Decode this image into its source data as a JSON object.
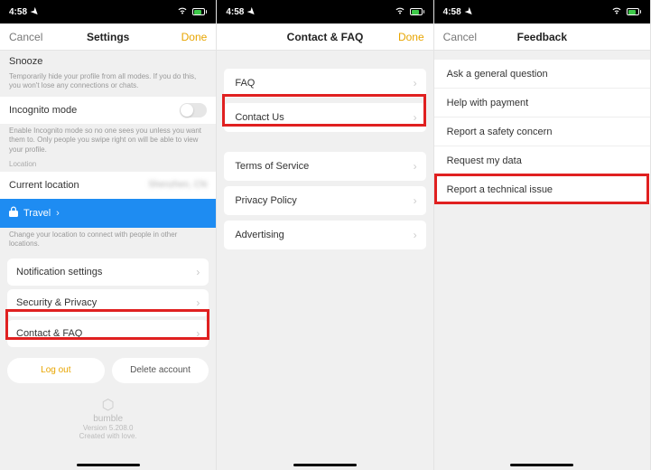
{
  "status": {
    "time": "4:58",
    "wifi": "wifi",
    "battery": "charging"
  },
  "panel1": {
    "nav": {
      "left": "Cancel",
      "title": "Settings",
      "right": "Done"
    },
    "snooze": {
      "title": "Snooze",
      "helper": "Temporarily hide your profile from all modes. If you do this, you won't lose any connections or chats."
    },
    "incognito": {
      "label": "Incognito mode",
      "enabled": false,
      "helper": "Enable Incognito mode so no one sees you unless you want them to. Only people you swipe right on will be able to view your profile."
    },
    "locationCaption": "Location",
    "currentLocation": {
      "label": "Current location",
      "value": "Shenzhen, CN"
    },
    "travel": {
      "label": "Travel",
      "helper": "Change your location to connect with people in other locations."
    },
    "rows": [
      {
        "label": "Notification settings"
      },
      {
        "label": "Security & Privacy"
      },
      {
        "label": "Contact & FAQ"
      }
    ],
    "buttons": {
      "logout": "Log out",
      "delete": "Delete account"
    },
    "footer": {
      "brand": "bumble",
      "version": "Version 5.208.0",
      "tagline": "Created with love."
    }
  },
  "panel2": {
    "nav": {
      "left": "",
      "title": "Contact & FAQ",
      "right": "Done"
    },
    "group1": [
      {
        "label": "FAQ"
      },
      {
        "label": "Contact Us"
      }
    ],
    "group2": [
      {
        "label": "Terms of Service"
      },
      {
        "label": "Privacy Policy"
      },
      {
        "label": "Advertising"
      }
    ]
  },
  "panel3": {
    "nav": {
      "left": "Cancel",
      "title": "Feedback",
      "right": ""
    },
    "items": [
      {
        "label": "Ask a general question"
      },
      {
        "label": "Help with payment"
      },
      {
        "label": "Report a safety concern"
      },
      {
        "label": "Request my data"
      },
      {
        "label": "Report a technical issue"
      }
    ]
  }
}
